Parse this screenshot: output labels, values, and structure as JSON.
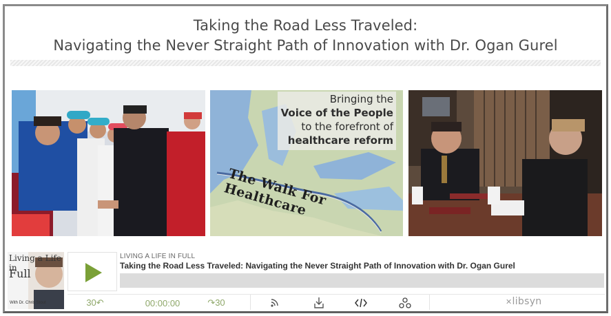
{
  "page": {
    "title_line1": "Taking the Road Less Traveled:",
    "title_line2": "Navigating the Never Straight Path of Innovation with Dr. Ogan Gurel"
  },
  "photos": {
    "map_caption_line1": "Bringing the",
    "map_caption_line2": "Voice of the People",
    "map_caption_line3": "to the forefront of",
    "map_caption_line4": "healthcare reform",
    "map_route_text": "The Walk For Healthcare"
  },
  "player": {
    "cover_line1": "Living a Life in",
    "cover_line2": "Full",
    "cover_credit": "With Dr. Chris Stout",
    "show_name": "LIVING A LIFE IN FULL",
    "episode_title": "Taking the Road Less Traveled: Navigating the Never Straight Path of Innovation with Dr. Ogan Gurel",
    "progress_fraction": 0,
    "rewind_label": "30↶",
    "time": "00:00:00",
    "forward_label": "↷30",
    "brand": "libsyn",
    "icons": [
      "play-icon",
      "rss-icon",
      "download-icon",
      "embed-code-icon",
      "share-icon",
      "libsyn-logo-icon"
    ],
    "accent_color": "#7aa037"
  }
}
